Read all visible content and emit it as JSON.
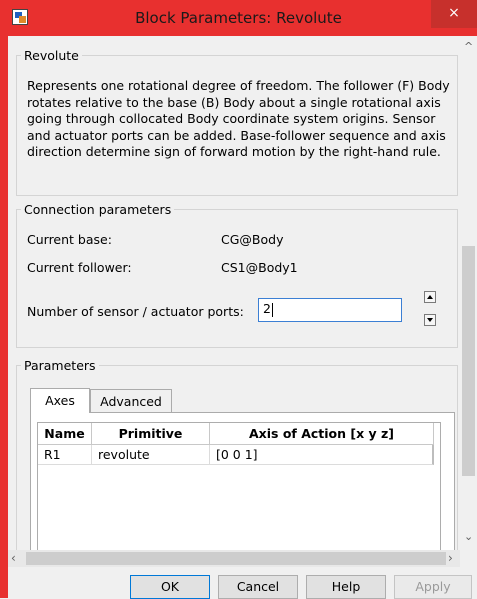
{
  "window": {
    "title": "Block Parameters: Revolute",
    "close_label": "×"
  },
  "block": {
    "name": "Revolute",
    "description": "Represents one rotational degree of freedom. The follower (F) Body rotates relative to the base (B) Body about a single rotational axis going through collocated Body coordinate system origins. Sensor and actuator ports can be added. Base-follower sequence and axis direction determine sign of forward motion by the right-hand rule."
  },
  "connection": {
    "legend": "Connection parameters",
    "base_label": "Current base:",
    "base_value": "CG@Body",
    "follower_label": "Current follower:",
    "follower_value": "CS1@Body1",
    "ports_label": "Number of sensor / actuator ports:",
    "ports_value": "2"
  },
  "parameters": {
    "legend": "Parameters",
    "tabs": [
      {
        "label": "Axes",
        "active": true
      },
      {
        "label": "Advanced",
        "active": false
      }
    ],
    "table": {
      "columns": [
        "Name",
        "Primitive",
        "Axis of Action [x y z]"
      ],
      "rows": [
        {
          "name": "R1",
          "primitive": "revolute",
          "axis": "[0 0 1]"
        }
      ]
    }
  },
  "buttons": {
    "ok": "OK",
    "cancel": "Cancel",
    "help": "Help",
    "apply": "Apply"
  },
  "colors": {
    "titlebar": "#e8302f",
    "close": "#c7302c",
    "focus": "#0078d7"
  }
}
